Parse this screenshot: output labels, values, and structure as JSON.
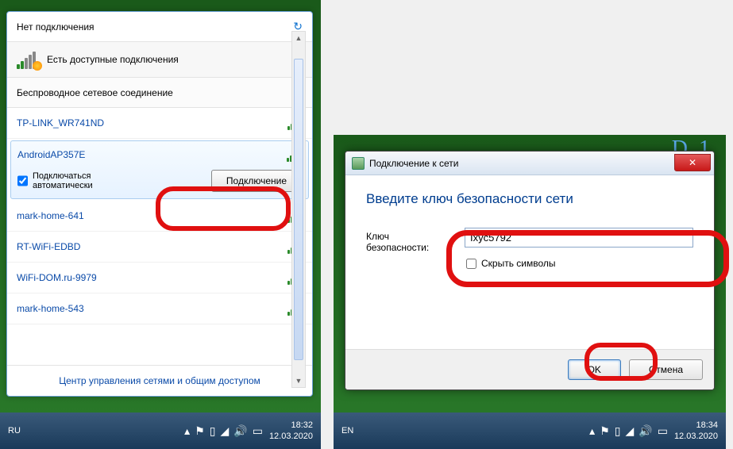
{
  "flyout": {
    "title": "Нет подключения",
    "available_label": "Есть доступные подключения",
    "section_label": "Беспроводное сетевое соединение",
    "networks": [
      {
        "ssid": "TP-LINK_WR741ND"
      },
      {
        "ssid": "AndroidAP357E"
      },
      {
        "ssid": "mark-home-641"
      },
      {
        "ssid": "RT-WiFi-EDBD"
      },
      {
        "ssid": "WiFi-DOM.ru-9979"
      },
      {
        "ssid": "mark-home-543"
      }
    ],
    "auto_connect_label": "Подключаться автоматически",
    "auto_connect_checked": true,
    "connect_button": "Подключение",
    "footer_link": "Центр управления сетями и общим доступом"
  },
  "dialog": {
    "title": "Подключение к сети",
    "heading": "Введите ключ безопасности сети",
    "key_label": "Ключ безопасности:",
    "key_value": "Ixyc5792",
    "hide_chars_label": "Скрыть символы",
    "hide_chars_checked": false,
    "ok_label": "OK",
    "cancel_label": "Отмена"
  },
  "taskbar1": {
    "lang": "RU",
    "time": "18:32",
    "date": "12.03.2020"
  },
  "taskbar2": {
    "lang": "EN",
    "time": "18:34",
    "date": "12.03.2020"
  }
}
